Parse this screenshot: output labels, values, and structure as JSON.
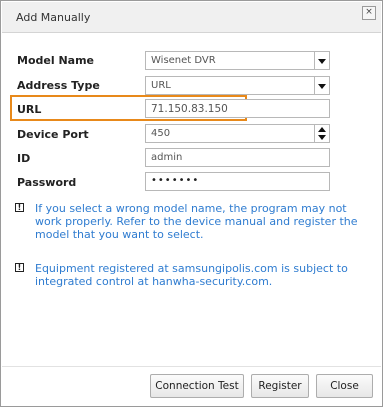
{
  "dialog": {
    "title": "Add Manually",
    "close_glyph": "×"
  },
  "form": {
    "model_name": {
      "label": "Model Name",
      "value": "Wisenet DVR"
    },
    "address_type": {
      "label": "Address Type",
      "value": "URL"
    },
    "url": {
      "label": "URL",
      "value": "71.150.83.150"
    },
    "device_port": {
      "label": "Device Port",
      "value": "450"
    },
    "id": {
      "label": "ID",
      "value": "admin"
    },
    "password": {
      "label": "Password",
      "value": "•••••••"
    }
  },
  "notes": {
    "icon_glyph": "!",
    "note1": "If you select a wrong model name, the program may not work properly. Refer to the device manual and register the model that you want to select.",
    "note2": "Equipment registered at samsungipolis.com is subject to integrated control at hanwha-security.com."
  },
  "buttons": {
    "connection_test": "Connection Test",
    "register": "Register",
    "close": "Close"
  },
  "colors": {
    "note_text": "#2f7cd0",
    "highlight": "#e8891a"
  }
}
